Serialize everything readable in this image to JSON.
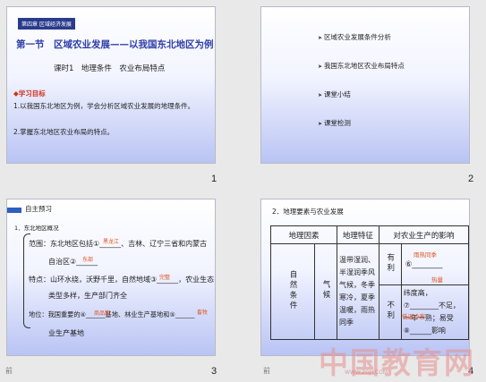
{
  "slide1": {
    "tag": "第四章 区域经济发展",
    "title": "第一节　区域农业发展——以我国东北地区为例",
    "subtitle": "课时1　地理条件　农业布局特点",
    "goal_heading": "◆学习目标",
    "goal1": "1.以我国东北地区为例，学会分析区域农业发展的地理条件。",
    "goal2": "2.掌握东北地区农业布局的特点。",
    "number": "1"
  },
  "slide2": {
    "items": [
      "区域农业发展条件分析",
      "我国东北地区农业布局特点",
      "课堂小结",
      "课堂检测"
    ],
    "number": "2"
  },
  "slide3": {
    "head": "自主预习",
    "section": "1．东北地区概况",
    "range_line1": "范围：东北地区包括①______、吉林、辽宁三省和内蒙古",
    "range_ans1": "黑龙江",
    "range_line2": "自治区②______",
    "range_ans2": "东部",
    "feature_line1": "特点：山环水绕，沃野千里，自然地域③______，农业生态",
    "feature_ans": "完整",
    "feature_line2": "类型多样，生产部门齐全",
    "location_line1": "地位：我国重要的④______基地、林业生产基地和⑤______",
    "location_ans1": "商品粮",
    "location_ans2": "畜牧",
    "location_line2": "业生产基地",
    "footer": "前",
    "number": "3"
  },
  "slide4": {
    "head": "2．地理要素与农业发展",
    "col1": "地理因素",
    "col2": "地理特征",
    "col3": "对农业生产的影响",
    "row_label": "自然条件",
    "row_sub": "气候",
    "feature1": "温带湿润、半湿润季风",
    "effect1_tag": "有利",
    "effect1": "⑥________",
    "ans1": "雨热同季",
    "ans1b": "热量",
    "feature2": "气候，冬季寒冷，夏季温暖，雨热同季",
    "effect2_tag": "不利",
    "effect2": "纬度高，⑦________不足，一年一熟；易受⑧______影响",
    "ans2": "低温冷害",
    "footer": "前",
    "number": "4"
  },
  "watermark": "中国教育网",
  "watermark_sub": "WWW.ZGJY.COM"
}
